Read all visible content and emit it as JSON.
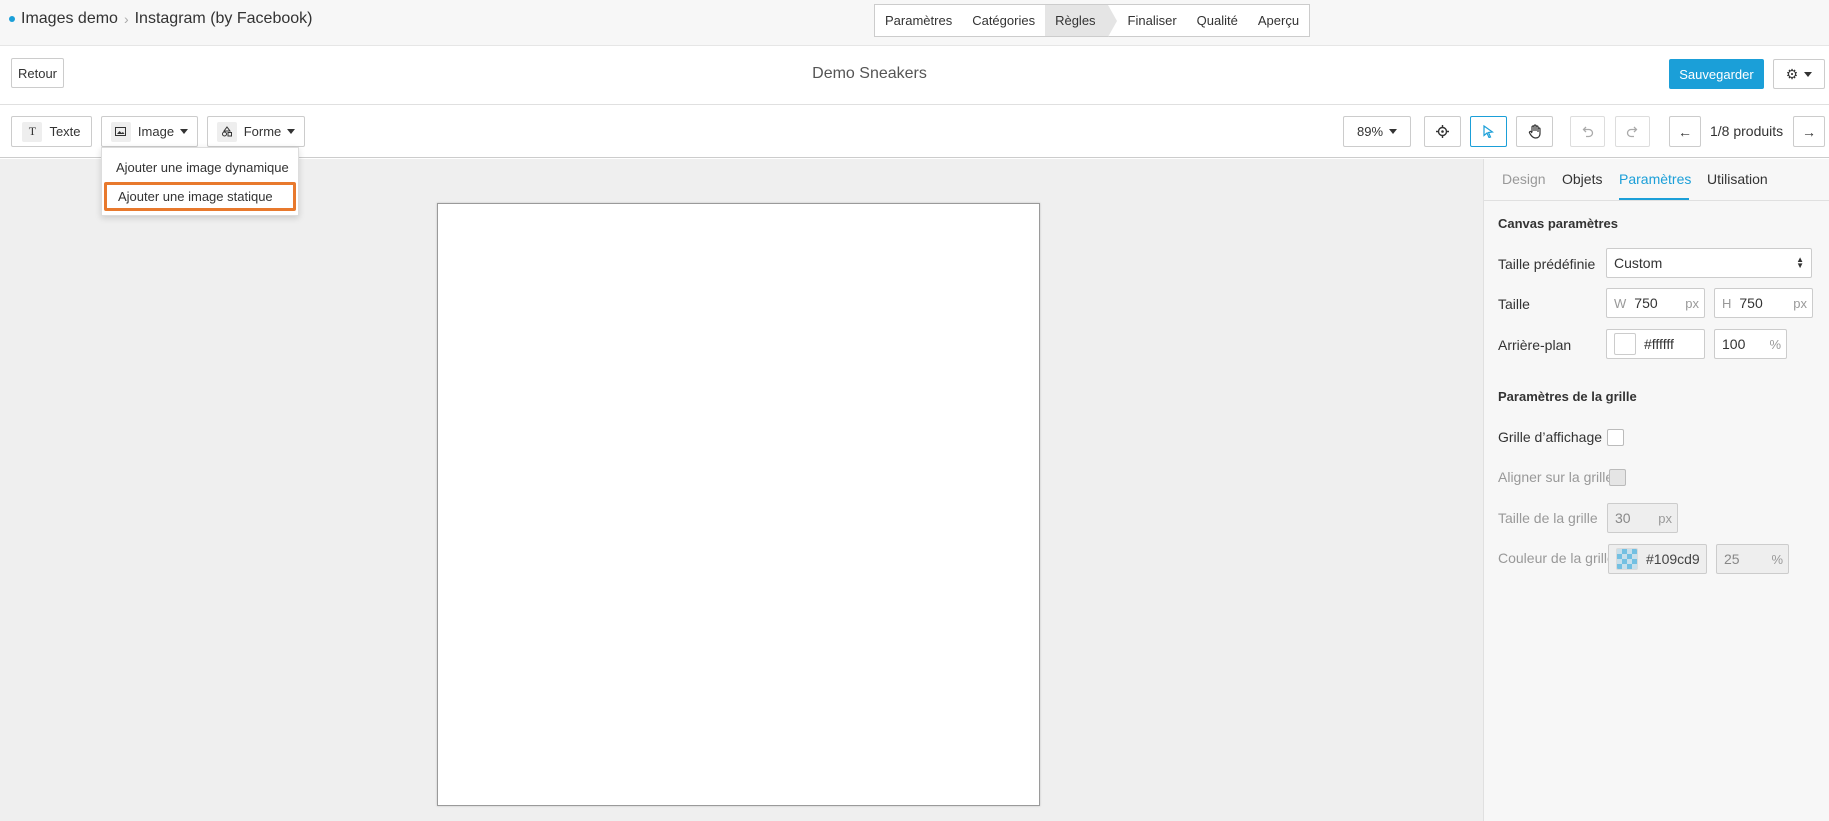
{
  "header": {
    "breadcrumb": [
      "Images demo",
      "Instagram (by Facebook)"
    ],
    "steps": [
      "Paramètres",
      "Catégories",
      "Règles",
      "Finaliser",
      "Qualité",
      "Aperçu"
    ],
    "active_step": "Règles"
  },
  "row2": {
    "back_label": "Retour",
    "title": "Demo Sneakers",
    "save_label": "Sauvegarder"
  },
  "toolbar": {
    "text_label": "Texte",
    "image_label": "Image",
    "shape_label": "Forme",
    "zoom": "89%",
    "pagination": "1/8 produits"
  },
  "image_menu": {
    "items": [
      "Ajouter une image dynamique",
      "Ajouter une image statique"
    ],
    "highlighted": "Ajouter une image statique"
  },
  "panel": {
    "tabs": [
      "Design",
      "Objets",
      "Paramètres",
      "Utilisation"
    ],
    "active_tab": "Paramètres",
    "canvas": {
      "title": "Canvas paramètres",
      "preset_label": "Taille prédéfinie",
      "preset_value": "Custom",
      "size_label": "Taille",
      "w_prefix": "W",
      "w_value": "750",
      "h_prefix": "H",
      "h_value": "750",
      "unit": "px",
      "bg_label": "Arrière-plan",
      "bg_color": "#ffffff",
      "bg_opacity": "100",
      "opacity_unit": "%"
    },
    "grid": {
      "title": "Paramètres de la grille",
      "show_label": "Grille d’affichage",
      "snap_label": "Aligner sur la grille",
      "size_label": "Taille de la grille",
      "size_value": "30",
      "color_label": "Couleur de la grille",
      "color_value": "#109cd9",
      "opacity_value": "25"
    }
  },
  "colors": {
    "accent": "#1b9fd8",
    "highlight_border": "#e8792d",
    "workspace_bg": "#efefef"
  }
}
